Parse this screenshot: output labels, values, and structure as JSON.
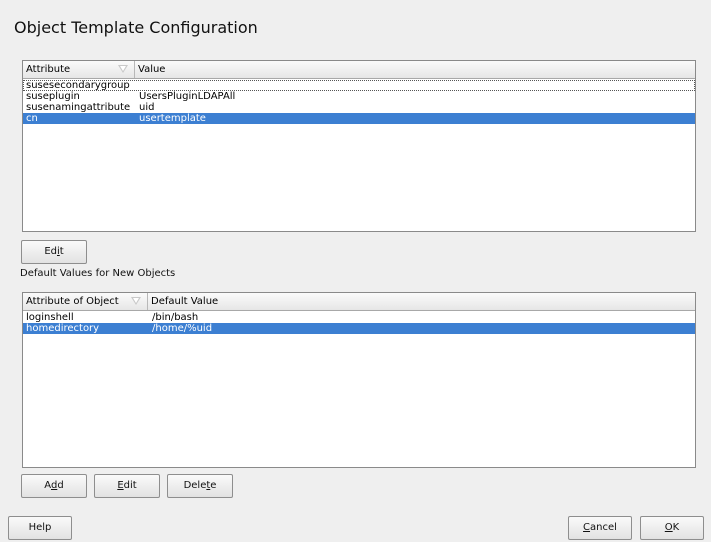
{
  "window": {
    "title": "Object Template Configuration"
  },
  "template_table": {
    "columns": [
      "Attribute",
      "Value"
    ],
    "rows": [
      {
        "attribute": "susesecondarygroup",
        "value": ""
      },
      {
        "attribute": "suseplugin",
        "value": "UsersPluginLDAPAll"
      },
      {
        "attribute": "susenamingattribute",
        "value": "uid"
      },
      {
        "attribute": "cn",
        "value": "usertemplate"
      }
    ],
    "selected_index": 3
  },
  "template_edit_button": {
    "pre": "Ed",
    "key": "i",
    "post": "t"
  },
  "defaults_label": "Default Values for New Objects",
  "defaults_table": {
    "columns": [
      "Attribute of Object",
      "Default Value"
    ],
    "rows": [
      {
        "attribute": "loginshell",
        "value": "/bin/bash"
      },
      {
        "attribute": "homedirectory",
        "value": "/home/%uid"
      }
    ],
    "selected_index": 1
  },
  "defaults_buttons": {
    "add": {
      "pre": "A",
      "key": "d",
      "post": "d"
    },
    "edit": {
      "pre": "",
      "key": "E",
      "post": "dit"
    },
    "delete": {
      "pre": "Dele",
      "key": "t",
      "post": "e"
    }
  },
  "footer": {
    "help": "Help",
    "cancel": {
      "pre": "",
      "key": "C",
      "post": "ancel"
    },
    "ok": {
      "pre": "",
      "key": "O",
      "post": "K"
    }
  },
  "colors": {
    "selection": "#3c7fd2",
    "background": "#efefef"
  }
}
